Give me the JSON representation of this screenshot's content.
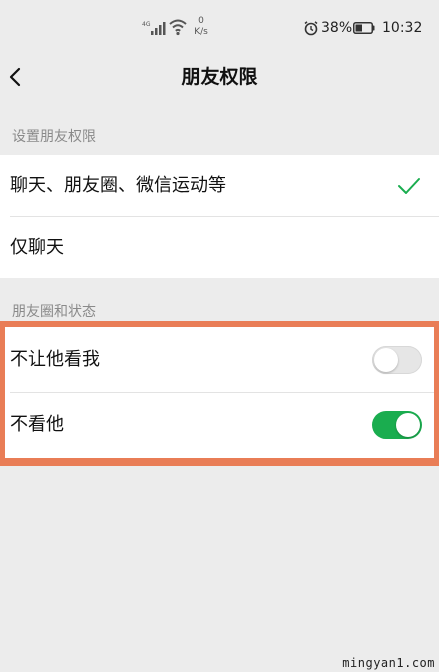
{
  "status_bar": {
    "network_type": "4G",
    "speed_value": "0",
    "speed_unit": "K/s",
    "battery_percent": "38%",
    "time": "10:32",
    "icons": [
      "signal-icon",
      "wifi-icon",
      "alarm-icon",
      "battery-icon"
    ]
  },
  "nav": {
    "back_icon": "chevron-left-icon",
    "title": "朋友权限"
  },
  "section_permissions": {
    "header": "设置朋友权限",
    "options": [
      {
        "label": "聊天、朋友圈、微信运动等",
        "selected": true
      },
      {
        "label": "仅聊天",
        "selected": false
      }
    ]
  },
  "section_moments": {
    "header": "朋友圈和状态",
    "rows": [
      {
        "label": "不让他看我",
        "toggle_on": false
      },
      {
        "label": "不看他",
        "toggle_on": true
      }
    ]
  },
  "colors": {
    "background": "#ececec",
    "accent_green": "#1aad4f",
    "highlight_orange": "#e97d56"
  },
  "watermark": "mingyan1.com"
}
